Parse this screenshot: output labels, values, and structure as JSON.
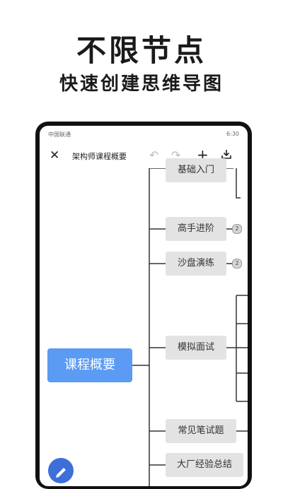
{
  "promo": {
    "headline": "不限节点",
    "subline": "快速创建思维导图"
  },
  "status_bar": {
    "carrier": "中国联通",
    "time": "6:30"
  },
  "toolbar": {
    "close_icon": "close-icon",
    "title": "架构师课程概要",
    "undo_icon": "undo-icon",
    "redo_icon": "redo-icon",
    "add_icon": "plus-icon",
    "download_icon": "download-icon"
  },
  "mindmap": {
    "root": "课程概要",
    "children": [
      {
        "label": "基础入门",
        "badge": ""
      },
      {
        "label": "高手进阶",
        "badge": "2"
      },
      {
        "label": "沙盘演练",
        "badge": "2"
      },
      {
        "label": "模拟面试",
        "badge": ""
      },
      {
        "label": "常见笔试题",
        "badge": ""
      },
      {
        "label": "大厂经验总结",
        "badge": ""
      }
    ]
  },
  "colors": {
    "root_node": "#5b9bf3",
    "child_node": "#e3e3e3",
    "fab": "#3d6fd8"
  }
}
